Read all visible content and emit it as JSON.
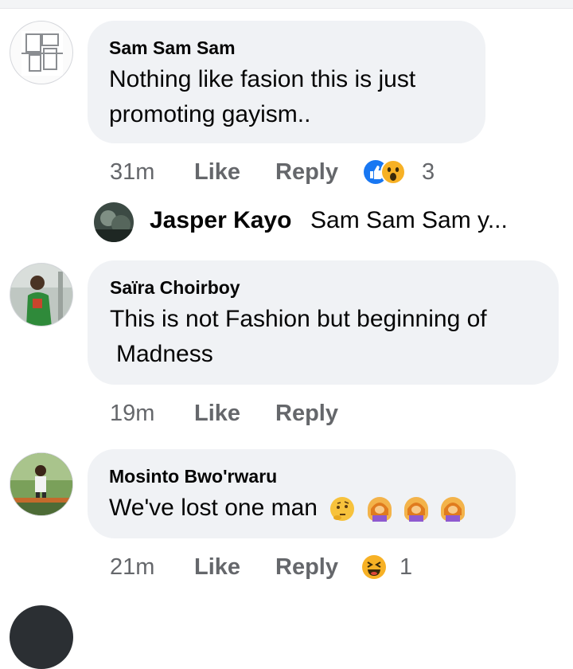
{
  "comments": [
    {
      "author": "Sam Sam Sam",
      "lines": [
        "Nothing like fasion this is just",
        "promoting gayism.."
      ],
      "time": "31m",
      "like_label": "Like",
      "reply_label": "Reply",
      "reactions": [
        "like-reaction",
        "wow-reaction"
      ],
      "reaction_count": "3",
      "reply": {
        "author": "Jasper Kayo",
        "preview": "Sam Sam Sam y..."
      }
    },
    {
      "author": "Saïra Choirboy",
      "lines": [
        "This is not Fashion but beginning of",
        "Madness"
      ],
      "time": "19m",
      "like_label": "Like",
      "reply_label": "Reply"
    },
    {
      "author": "Mosinto Bwo'rwaru",
      "lines": [
        "We've lost one man"
      ],
      "emojis": [
        "thinking-face-emoji",
        "facepalm-emoji",
        "facepalm-emoji",
        "facepalm-emoji"
      ],
      "time": "21m",
      "like_label": "Like",
      "reply_label": "Reply",
      "reactions": [
        "haha-reaction"
      ],
      "reaction_count": "1"
    }
  ],
  "colors": {
    "bubble": "#f0f2f5",
    "secondary_text": "#65676b",
    "like_blue": "#1877f2"
  }
}
